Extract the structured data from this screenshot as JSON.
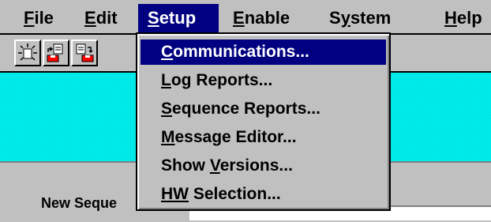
{
  "menubar": {
    "items": [
      {
        "pre": "",
        "key": "F",
        "post": "ile"
      },
      {
        "pre": "",
        "key": "E",
        "post": "dit"
      },
      {
        "pre": "",
        "key": "S",
        "post": "etup"
      },
      {
        "pre": "",
        "key": "E",
        "post": "nable"
      },
      {
        "pre": "S",
        "key": "y",
        "post": "stem"
      },
      {
        "pre": "",
        "key": "H",
        "post": "elp"
      }
    ],
    "active_index": 2
  },
  "toolbar": {
    "buttons": [
      "new-icon",
      "open-icon",
      "save-icon"
    ]
  },
  "setup_menu": {
    "items": [
      {
        "pre": "",
        "key": "C",
        "post": "ommunications..."
      },
      {
        "pre": "",
        "key": "L",
        "post": "og Reports..."
      },
      {
        "pre": "",
        "key": "S",
        "post": "equence Reports..."
      },
      {
        "pre": "",
        "key": "M",
        "post": "essage Editor..."
      },
      {
        "pre": "Show ",
        "key": "V",
        "post": "ersions..."
      },
      {
        "pre": "",
        "key": "HW",
        "post": " Selection..."
      }
    ],
    "selected_index": 0
  },
  "content": {
    "sequence_label": "New Seque"
  },
  "colors": {
    "menu_highlight": "#000080",
    "window_bg": "#c0c0c0",
    "content_bg": "#00ffff"
  }
}
